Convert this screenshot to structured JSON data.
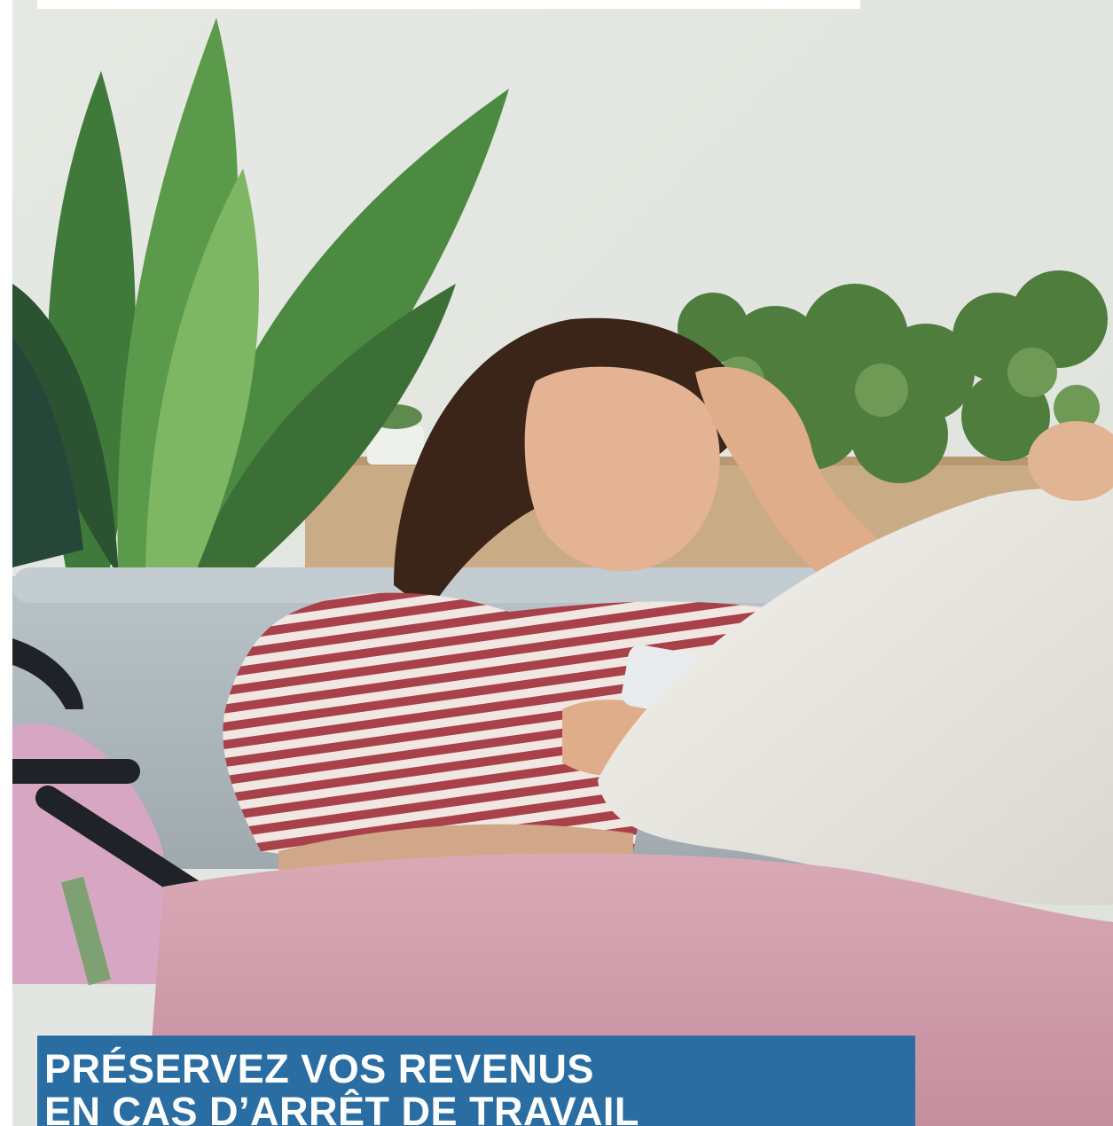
{
  "banner": {
    "headline_line1": "PRÉSERVEZ VOS REVENUS",
    "headline_line2": "EN CAS D’ARRÊT DE TRAVAIL",
    "box_color": "#2a6da3"
  },
  "photo": {
    "subject": "woman-with-leg-cast-on-sofa",
    "icons": [
      "smartphone",
      "crutch",
      "plants"
    ]
  }
}
